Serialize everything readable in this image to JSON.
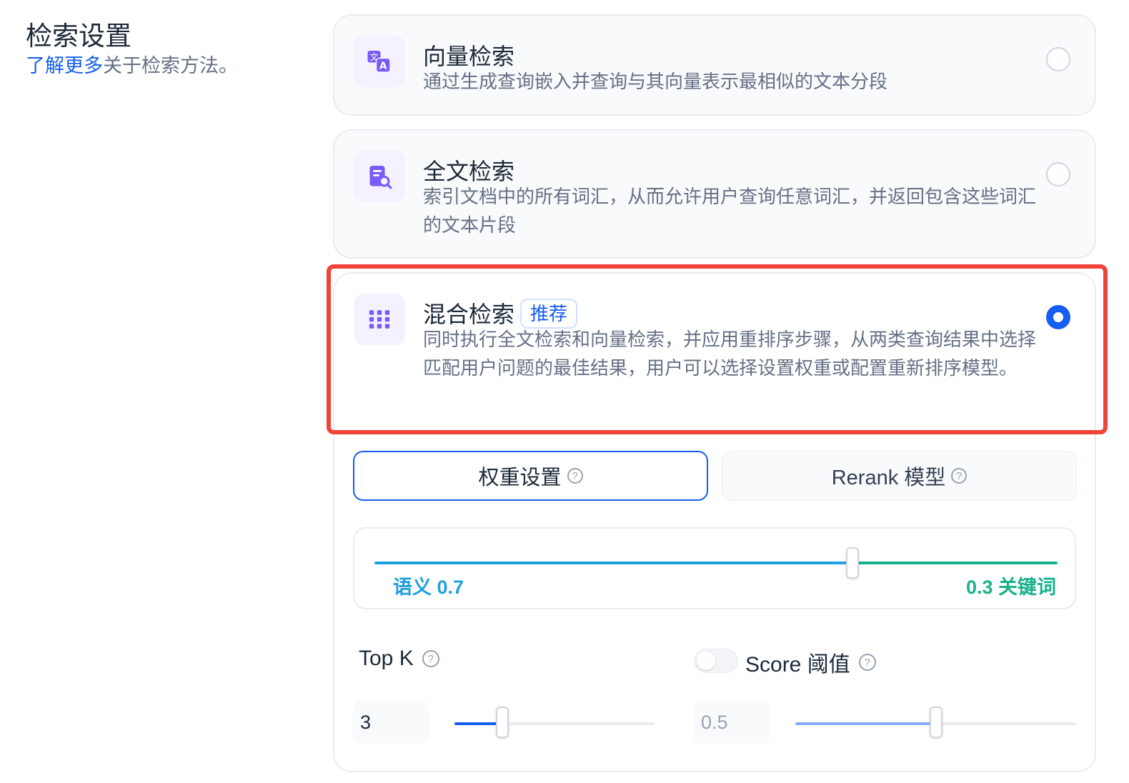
{
  "header": {
    "title": "检索设置",
    "subtitle_link": "了解更多",
    "subtitle_rest": "关于检索方法。"
  },
  "methods": [
    {
      "title": "向量检索",
      "description": "通过生成查询嵌入并查询与其向量表示最相似的文本分段",
      "icon": "translate-icon",
      "selected": false
    },
    {
      "title": "全文检索",
      "description": "索引文档中的所有词汇，从而允许用户查询任意词汇，并返回包含这些词汇的文本片段",
      "icon": "document-search-icon",
      "selected": false
    },
    {
      "title": "混合检索",
      "badge": "推荐",
      "description": "同时执行全文检索和向量检索，并应用重排序步骤，从两类查询结果中选择匹配用户问题的最佳结果，用户可以选择设置权重或配置重新排序模型。",
      "icon": "grid-dots-icon",
      "selected": true
    }
  ],
  "tabs": {
    "weight_label": "权重设置",
    "rerank_label": "Rerank 模型",
    "active": "weight"
  },
  "weights": {
    "semantic_label": "语义 0.7",
    "keyword_label": "0.3 关键词",
    "semantic": 0.7,
    "keyword": 0.3
  },
  "top_k": {
    "label": "Top K",
    "value": "3",
    "slider_fraction": 0.24
  },
  "score_threshold": {
    "label": "Score 阈值",
    "value": "0.5",
    "enabled": false,
    "slider_fraction": 0.5
  },
  "colors": {
    "primary": "#155eef",
    "semantic": "#1ea0e0",
    "keyword": "#17b28b",
    "highlight": "#f04438",
    "icon_purple": "#7a5af8"
  }
}
